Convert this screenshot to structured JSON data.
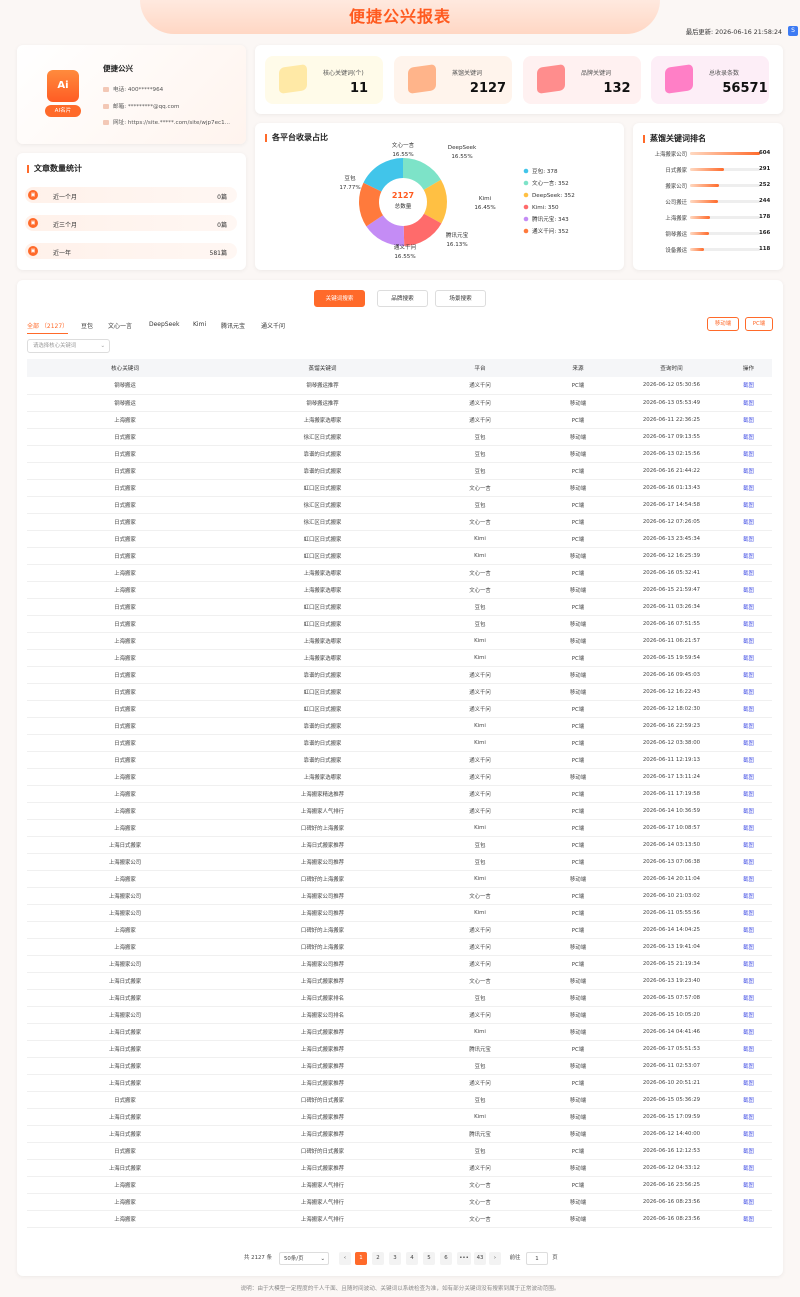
{
  "header": {
    "title": "便捷公兴报表",
    "updated_label": "最后更新: 2026-06-16 21:58:24",
    "corner_icon": "app-icon"
  },
  "profile": {
    "logo_text": "Ai",
    "ai_button": "AI名片",
    "name": "便捷公兴",
    "phone": "电话:  400*****964",
    "email": "邮箱:  *********@qq.com",
    "website": "网址:  https://site.*****.com/site/wjp7ec1..."
  },
  "stats": [
    {
      "label": "核心关键词(个)",
      "value": "11",
      "color": "#ffe9a6",
      "bg": "#fffbe9"
    },
    {
      "label": "蒸馏关键词",
      "value": "2127",
      "color": "#ffb48a",
      "bg": "#fff4ec"
    },
    {
      "label": "品牌关键词",
      "value": "132",
      "color": "#ff8d8d",
      "bg": "#fff1f1"
    },
    {
      "label": "总收录条数",
      "value": "56571",
      "color": "#ff7fc6",
      "bg": "#fdeef7"
    }
  ],
  "articles": {
    "title": "文章数量统计",
    "rows": [
      {
        "label": "近一个月",
        "value": "0篇"
      },
      {
        "label": "近三个月",
        "value": "0篇"
      },
      {
        "label": "近一年",
        "value": "581篇"
      }
    ]
  },
  "share": {
    "title": "各平台收录占比",
    "total": "2127",
    "total_label": "总数量"
  },
  "chart_data": {
    "type": "pie",
    "categories": [
      "文心一言",
      "DeepSeek",
      "Kimi",
      "腾讯元宝",
      "通义千问",
      "豆包"
    ],
    "values": [
      352,
      352,
      350,
      343,
      352,
      378
    ],
    "percents": [
      "16.55%",
      "16.55%",
      "16.45%",
      "16.13%",
      "16.55%",
      "17.77%"
    ],
    "colors": [
      "#7de3c8",
      "#ffc043",
      "#ff6b6b",
      "#c48cf5",
      "#ff7a3c",
      "#41c5ea"
    ],
    "legend": [
      "豆包: 378",
      "文心一言: 352",
      "DeepSeek: 352",
      "Kimi: 350",
      "腾讯元宝: 343",
      "通义千问: 352"
    ],
    "legend_colors": [
      "#41c5ea",
      "#7de3c8",
      "#ffc043",
      "#ff6b6b",
      "#c48cf5",
      "#ff7a3c"
    ],
    "legend_position": "right"
  },
  "ranks": {
    "title": "蒸馏关键词排名",
    "items": [
      {
        "label": "上海搬家公司",
        "value": "604",
        "ratio": 1.0
      },
      {
        "label": "日式搬家",
        "value": "291",
        "ratio": 0.48
      },
      {
        "label": "搬家公司",
        "value": "252",
        "ratio": 0.42
      },
      {
        "label": "公司搬迁",
        "value": "244",
        "ratio": 0.4
      },
      {
        "label": "上海搬家",
        "value": "178",
        "ratio": 0.29
      },
      {
        "label": "钢琴搬运",
        "value": "166",
        "ratio": 0.27
      },
      {
        "label": "设备搬运",
        "value": "118",
        "ratio": 0.2
      }
    ]
  },
  "tabs": [
    "关键词搜索",
    "品牌搜索",
    "场景搜索"
  ],
  "platform_tabs": [
    "全部 （2127）",
    "豆包",
    "文心一言",
    "DeepSeek",
    "Kimi",
    "腾讯元宝",
    "通义千问"
  ],
  "device_buttons": [
    "移动端",
    "PC端"
  ],
  "filter_placeholder": "请选择核心关键词",
  "table": {
    "headers": [
      "核心关键词",
      "蒸馏关键词",
      "平台",
      "来源",
      "查询时间",
      "操作"
    ],
    "rows": [
      [
        "钢琴搬运",
        "钢琴搬运推荐",
        "通义千问",
        "PC端",
        "2026-06-12 05:30:56",
        "截图"
      ],
      [
        "钢琴搬运",
        "钢琴搬运推荐",
        "通义千问",
        "移动端",
        "2026-06-13 05:53:49",
        "截图"
      ],
      [
        "上海搬家",
        "上海搬家选哪家",
        "通义千问",
        "PC端",
        "2026-06-11 22:36:25",
        "截图"
      ],
      [
        "日式搬家",
        "徐汇区日式搬家",
        "豆包",
        "移动端",
        "2026-06-17 09:13:55",
        "截图"
      ],
      [
        "日式搬家",
        "靠谱的日式搬家",
        "豆包",
        "移动端",
        "2026-06-13 02:15:56",
        "截图"
      ],
      [
        "日式搬家",
        "靠谱的日式搬家",
        "豆包",
        "PC端",
        "2026-06-16 21:44:22",
        "截图"
      ],
      [
        "日式搬家",
        "虹口区日式搬家",
        "文心一言",
        "移动端",
        "2026-06-16 01:13:43",
        "截图"
      ],
      [
        "日式搬家",
        "徐汇区日式搬家",
        "豆包",
        "PC端",
        "2026-06-17 14:54:58",
        "截图"
      ],
      [
        "日式搬家",
        "徐汇区日式搬家",
        "文心一言",
        "PC端",
        "2026-06-12 07:26:05",
        "截图"
      ],
      [
        "日式搬家",
        "虹口区日式搬家",
        "Kimi",
        "PC端",
        "2026-06-13 23:45:34",
        "截图"
      ],
      [
        "日式搬家",
        "虹口区日式搬家",
        "Kimi",
        "移动端",
        "2026-06-12 16:25:39",
        "截图"
      ],
      [
        "上海搬家",
        "上海搬家选哪家",
        "文心一言",
        "PC端",
        "2026-06-16 05:32:41",
        "截图"
      ],
      [
        "上海搬家",
        "上海搬家选哪家",
        "文心一言",
        "移动端",
        "2026-06-15 21:59:47",
        "截图"
      ],
      [
        "日式搬家",
        "虹口区日式搬家",
        "豆包",
        "PC端",
        "2026-06-11 03:26:34",
        "截图"
      ],
      [
        "日式搬家",
        "虹口区日式搬家",
        "豆包",
        "移动端",
        "2026-06-16 07:51:55",
        "截图"
      ],
      [
        "上海搬家",
        "上海搬家选哪家",
        "Kimi",
        "移动端",
        "2026-06-11 06:21:57",
        "截图"
      ],
      [
        "上海搬家",
        "上海搬家选哪家",
        "Kimi",
        "PC端",
        "2026-06-15 19:59:54",
        "截图"
      ],
      [
        "日式搬家",
        "靠谱的日式搬家",
        "通义千问",
        "移动端",
        "2026-06-16 09:45:03",
        "截图"
      ],
      [
        "日式搬家",
        "虹口区日式搬家",
        "通义千问",
        "移动端",
        "2026-06-12 16:22:43",
        "截图"
      ],
      [
        "日式搬家",
        "虹口区日式搬家",
        "通义千问",
        "PC端",
        "2026-06-12 18:02:30",
        "截图"
      ],
      [
        "日式搬家",
        "靠谱的日式搬家",
        "Kimi",
        "PC端",
        "2026-06-16 22:59:23",
        "截图"
      ],
      [
        "日式搬家",
        "靠谱的日式搬家",
        "Kimi",
        "PC端",
        "2026-06-12 03:38:00",
        "截图"
      ],
      [
        "日式搬家",
        "靠谱的日式搬家",
        "通义千问",
        "PC端",
        "2026-06-11 12:19:13",
        "截图"
      ],
      [
        "上海搬家",
        "上海搬家选哪家",
        "通义千问",
        "移动端",
        "2026-06-17 13:11:24",
        "截图"
      ],
      [
        "上海搬家",
        "上海搬家精选推荐",
        "通义千问",
        "PC端",
        "2026-06-11 17:19:58",
        "截图"
      ],
      [
        "上海搬家",
        "上海搬家人气排行",
        "通义千问",
        "PC端",
        "2026-06-14 10:36:59",
        "截图"
      ],
      [
        "上海搬家",
        "口碑好的上海搬家",
        "Kimi",
        "PC端",
        "2026-06-17 10:08:57",
        "截图"
      ],
      [
        "上海日式搬家",
        "上海日式搬家推荐",
        "豆包",
        "PC端",
        "2026-06-14 03:13:50",
        "截图"
      ],
      [
        "上海搬家公司",
        "上海搬家公司推荐",
        "豆包",
        "PC端",
        "2026-06-13 07:06:38",
        "截图"
      ],
      [
        "上海搬家",
        "口碑好的上海搬家",
        "Kimi",
        "移动端",
        "2026-06-14 20:11:04",
        "截图"
      ],
      [
        "上海搬家公司",
        "上海搬家公司推荐",
        "文心一言",
        "PC端",
        "2026-06-10 21:03:02",
        "截图"
      ],
      [
        "上海搬家公司",
        "上海搬家公司推荐",
        "Kimi",
        "PC端",
        "2026-06-11 05:55:56",
        "截图"
      ],
      [
        "上海搬家",
        "口碑好的上海搬家",
        "通义千问",
        "PC端",
        "2026-06-14 14:04:25",
        "截图"
      ],
      [
        "上海搬家",
        "口碑好的上海搬家",
        "通义千问",
        "移动端",
        "2026-06-13 19:41:04",
        "截图"
      ],
      [
        "上海搬家公司",
        "上海搬家公司推荐",
        "通义千问",
        "PC端",
        "2026-06-15 21:19:34",
        "截图"
      ],
      [
        "上海日式搬家",
        "上海日式搬家推荐",
        "文心一言",
        "移动端",
        "2026-06-13 19:23:40",
        "截图"
      ],
      [
        "上海日式搬家",
        "上海日式搬家排名",
        "豆包",
        "移动端",
        "2026-06-15 07:57:08",
        "截图"
      ],
      [
        "上海搬家公司",
        "上海搬家公司排名",
        "通义千问",
        "移动端",
        "2026-06-15 10:05:20",
        "截图"
      ],
      [
        "上海日式搬家",
        "上海日式搬家推荐",
        "Kimi",
        "移动端",
        "2026-06-14 04:41:46",
        "截图"
      ],
      [
        "上海日式搬家",
        "上海日式搬家推荐",
        "腾讯元宝",
        "PC端",
        "2026-06-17 05:51:53",
        "截图"
      ],
      [
        "上海日式搬家",
        "上海日式搬家推荐",
        "豆包",
        "移动端",
        "2026-06-11 02:53:07",
        "截图"
      ],
      [
        "上海日式搬家",
        "上海日式搬家推荐",
        "通义千问",
        "PC端",
        "2026-06-10 20:51:21",
        "截图"
      ],
      [
        "日式搬家",
        "口碑好的日式搬家",
        "豆包",
        "移动端",
        "2026-06-15 05:36:29",
        "截图"
      ],
      [
        "上海日式搬家",
        "上海日式搬家推荐",
        "Kimi",
        "移动端",
        "2026-06-15 17:09:59",
        "截图"
      ],
      [
        "上海日式搬家",
        "上海日式搬家推荐",
        "腾讯元宝",
        "移动端",
        "2026-06-12 14:40:00",
        "截图"
      ],
      [
        "日式搬家",
        "口碑好的日式搬家",
        "豆包",
        "PC端",
        "2026-06-16 12:12:53",
        "截图"
      ],
      [
        "上海日式搬家",
        "上海日式搬家推荐",
        "通义千问",
        "移动端",
        "2026-06-12 04:33:12",
        "截图"
      ],
      [
        "上海搬家",
        "上海搬家人气排行",
        "文心一言",
        "PC端",
        "2026-06-16 23:56:25",
        "截图"
      ],
      [
        "上海搬家",
        "上海搬家人气排行",
        "文心一言",
        "移动端",
        "2026-06-16 08:23:56",
        "截图"
      ],
      [
        "上海搬家",
        "上海搬家人气排行",
        "文心一言",
        "移动端",
        "2026-06-16 08:23:56",
        "截图"
      ]
    ]
  },
  "pager": {
    "total": "共 2127 条",
    "page_size": "50条/页",
    "prev": "‹",
    "next": "›",
    "pages": [
      "1",
      "2",
      "3",
      "4",
      "5",
      "6",
      "•••",
      "43"
    ],
    "goto": "前往",
    "goto_value": "1",
    "page_unit": "页"
  },
  "footer": "说明：由于大模型一定程度的千人千面、且随时间波动、关键词以系统检查为准，如有部分关键词没有搜索到属于正常波动范围。"
}
